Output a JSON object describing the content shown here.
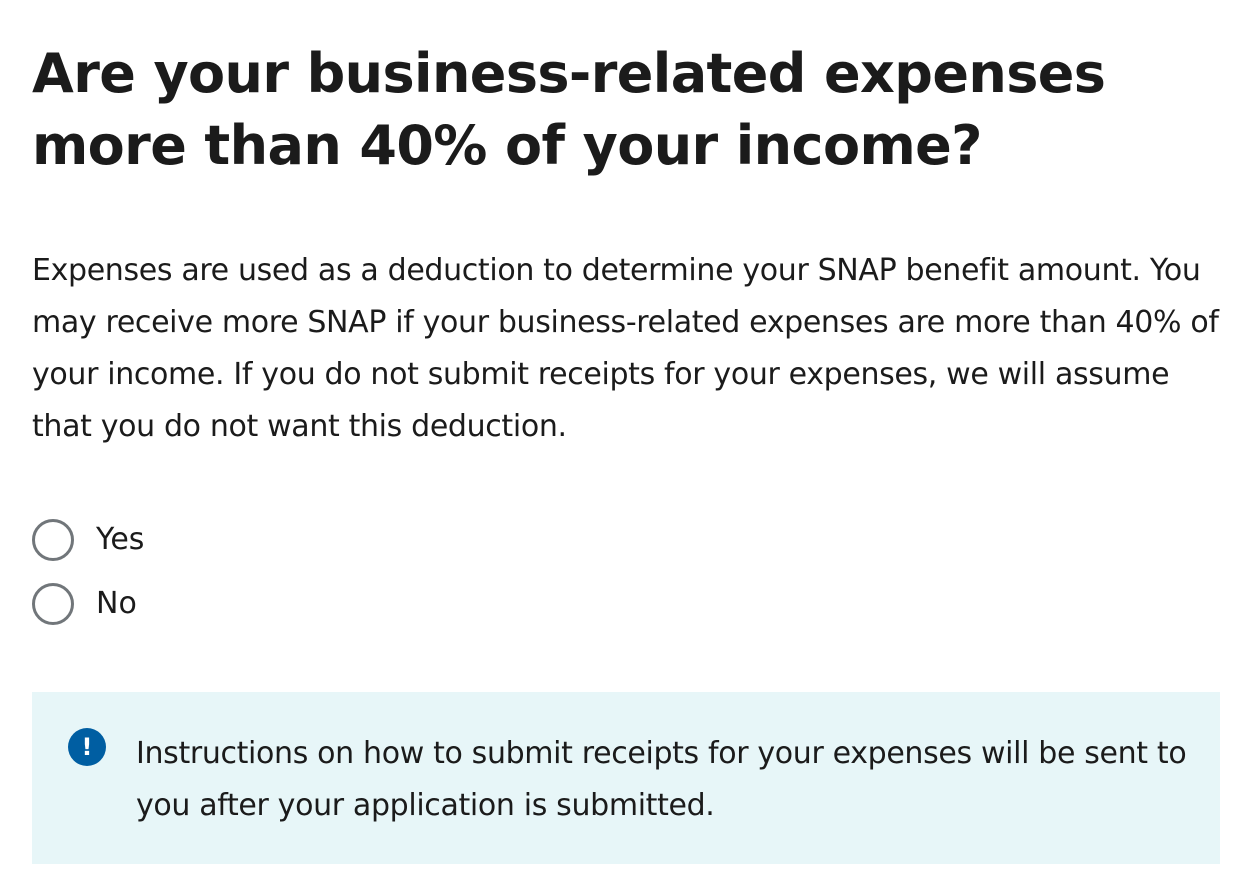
{
  "question": {
    "title": "Are your business-related expenses more than 40% of your income?",
    "description": "Expenses are used as a deduction to determine your SNAP benefit amount. You may receive more SNAP if your business-related expenses are more than 40% of your income. If you do not submit receipts for your expenses, we will assume that you do not want this deduction."
  },
  "options": [
    {
      "label": "Yes",
      "selected": false
    },
    {
      "label": "No",
      "selected": false
    }
  ],
  "alert": {
    "icon": "exclamation-icon",
    "icon_glyph": "!",
    "text": "Instructions on how to submit receipts for your expenses will be sent to you after your application is submitted."
  },
  "colors": {
    "alert_background": "#e7f6f8",
    "alert_icon": "#005ea2",
    "radio_border": "#71767a"
  }
}
